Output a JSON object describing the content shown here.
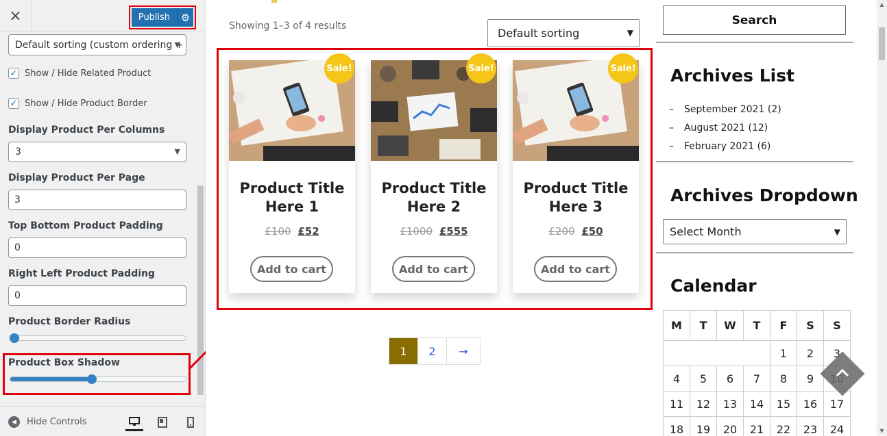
{
  "customizer": {
    "close_icon": "×",
    "publish_label": "Publish",
    "sorting_select": "Default sorting (custom ordering + r",
    "check_related": "Show / Hide Related Product",
    "check_border": "Show / Hide Product Border",
    "per_columns_label": "Display Product Per Columns",
    "per_columns_value": "3",
    "per_page_label": "Display Product Per Page",
    "per_page_value": "3",
    "tb_padding_label": "Top Bottom Product Padding",
    "tb_padding_value": "0",
    "rl_padding_label": "Right Left Product Padding",
    "rl_padding_value": "0",
    "border_radius_label": "Product Border Radius",
    "border_radius_level": 0.0,
    "box_shadow_label": "Product Box Shadow",
    "box_shadow_level": 0.47,
    "hide_controls": "Hide Controls"
  },
  "shop": {
    "result_count": "Showing 1–3 of 4 results",
    "orderby": "Default sorting",
    "sale_badge": "Sale!",
    "add_to_cart": "Add to cart",
    "products": [
      {
        "title_1": "Product Title",
        "title_2": "Here 1",
        "old_price": "£100",
        "new_price": "£52"
      },
      {
        "title_1": "Product Title",
        "title_2": "Here 2",
        "old_price": "£1000",
        "new_price": "£555"
      },
      {
        "title_1": "Product Title",
        "title_2": "Here 3",
        "old_price": "£200",
        "new_price": "£50"
      }
    ],
    "pagination": {
      "current": "1",
      "page2": "2",
      "next": "→"
    }
  },
  "sidebar": {
    "search": "Search",
    "archives_title": "Archives List",
    "archives": [
      {
        "dash": "–",
        "label": "September 2021 (2)"
      },
      {
        "dash": "–",
        "label": "August 2021 (12)"
      },
      {
        "dash": "–",
        "label": "February 2021 (6)"
      }
    ],
    "dropdown_title": "Archives Dropdown",
    "dropdown_value": "Select Month",
    "calendar_title": "Calendar",
    "calendar_days": [
      "M",
      "T",
      "W",
      "T",
      "F",
      "S",
      "S"
    ],
    "calendar_rows": [
      [
        "",
        "",
        "",
        "",
        "1",
        "2",
        "3"
      ],
      [
        "4",
        "5",
        "6",
        "7",
        "8",
        "9",
        "10"
      ],
      [
        "11",
        "12",
        "13",
        "14",
        "15",
        "16",
        "17"
      ],
      [
        "18",
        "19",
        "20",
        "21",
        "22",
        "23",
        "24"
      ]
    ]
  },
  "colors": {
    "highlight": "#e0000b",
    "publish": "#2271b1",
    "sale": "#f5c518",
    "current_page": "#8a6d00"
  }
}
